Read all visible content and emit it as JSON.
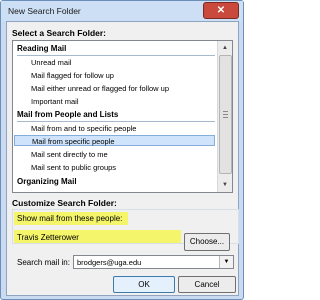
{
  "window": {
    "title": "New Search Folder",
    "close_glyph": "✕"
  },
  "picker": {
    "label": "Select a Search Folder:",
    "groups": [
      {
        "label": "Reading Mail",
        "items": [
          "Unread mail",
          "Mail flagged for follow up",
          "Mail either unread or flagged for follow up",
          "Important mail"
        ]
      },
      {
        "label": "Mail from People and Lists",
        "items": [
          "Mail from and to specific people",
          "Mail from specific people",
          "Mail sent directly to me",
          "Mail sent to public groups"
        ]
      },
      {
        "label": "Organizing Mail",
        "items": []
      }
    ],
    "selected_item": "Mail from specific people"
  },
  "customize": {
    "label": "Customize Search Folder:",
    "criteria_text": "Show mail from these people:",
    "criteria_value": "Travis Zetterower",
    "choose_label": "Choose...",
    "search_in_label": "Search mail in:",
    "search_in_value": "brodgers@uga.edu"
  },
  "buttons": {
    "ok": "OK",
    "cancel": "Cancel"
  },
  "colors": {
    "highlight": "#f4f56a",
    "selection": "#cfe3fb",
    "close": "#c94a3c"
  },
  "icons": {
    "scroll_up": "▲",
    "scroll_down": "▼",
    "dropdown": "▼"
  }
}
